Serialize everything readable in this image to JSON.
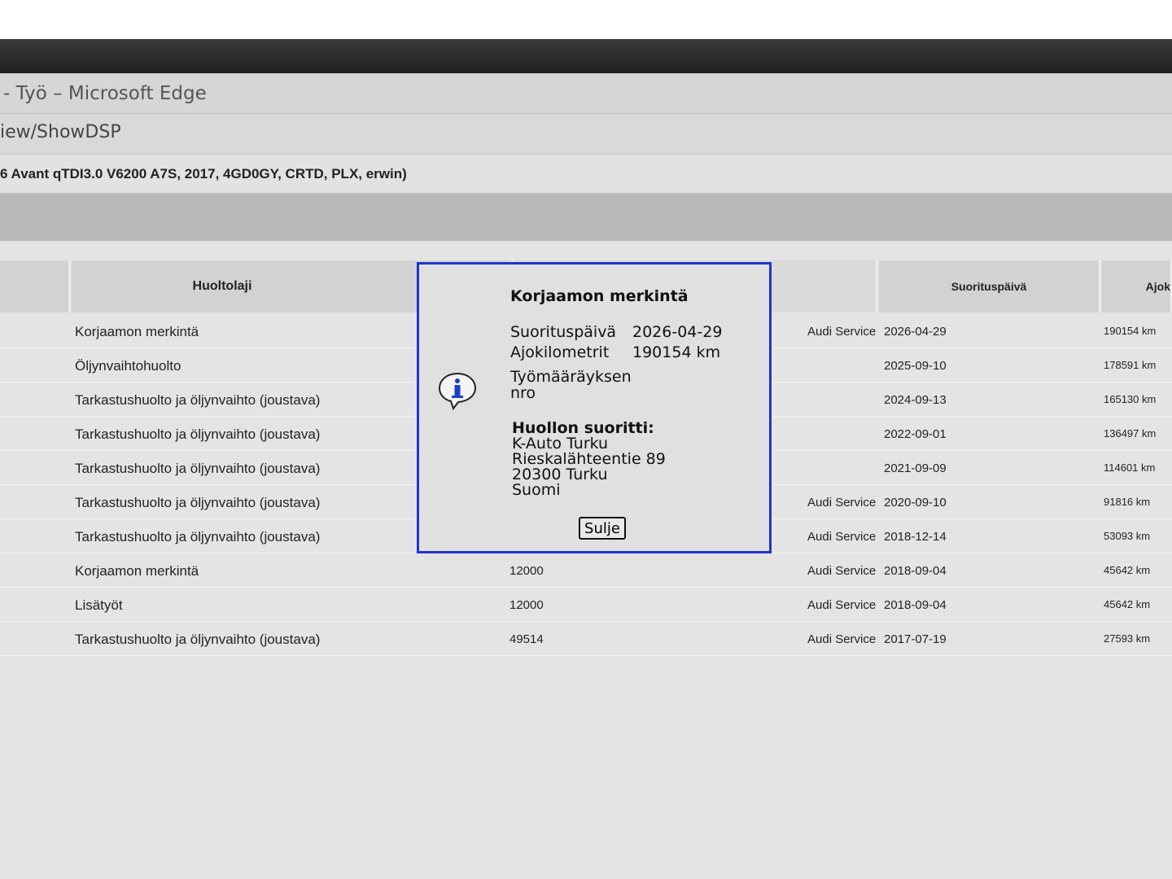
{
  "window": {
    "title": "- Työ – Microsoft Edge",
    "url_fragment": "iew/ShowDSP"
  },
  "vehicle": {
    "info": "6 Avant qTDI3.0 V6200 A7S, 2017, 4GD0GY, CRTD, PLX, erwin)"
  },
  "table": {
    "headers": {
      "service_type": "Huoltolaji",
      "date": "Suorituspäivä",
      "km": "Ajok"
    },
    "rows": [
      {
        "service_type": "Korjaamon merkintä",
        "mid": "",
        "performer": "Audi Service",
        "date": "2026-04-29",
        "km": "190154 km"
      },
      {
        "service_type": "Öljynvaihtohuolto",
        "mid": "",
        "performer": "",
        "date": "2025-09-10",
        "km": "178591 km"
      },
      {
        "service_type": "Tarkastushuolto ja öljynvaihto (joustava)",
        "mid": "",
        "performer": "",
        "date": "2024-09-13",
        "km": "165130 km"
      },
      {
        "service_type": "Tarkastushuolto ja öljynvaihto (joustava)",
        "mid": "",
        "performer": "",
        "date": "2022-09-01",
        "km": "136497 km"
      },
      {
        "service_type": "Tarkastushuolto ja öljynvaihto (joustava)",
        "mid": "",
        "performer": "",
        "date": "2021-09-09",
        "km": "114601 km"
      },
      {
        "service_type": "Tarkastushuolto ja öljynvaihto (joustava)",
        "mid": "",
        "performer": "Audi Service",
        "date": "2020-09-10",
        "km": "91816 km"
      },
      {
        "service_type": "Tarkastushuolto ja öljynvaihto (joustava)",
        "mid": "",
        "performer": "Audi Service",
        "date": "2018-12-14",
        "km": "53093 km"
      },
      {
        "service_type": "Korjaamon merkintä",
        "mid": "12000",
        "performer": "Audi Service",
        "date": "2018-09-04",
        "km": "45642 km"
      },
      {
        "service_type": "Lisätyöt",
        "mid": "12000",
        "performer": "Audi Service",
        "date": "2018-09-04",
        "km": "45642 km"
      },
      {
        "service_type": "Tarkastushuolto ja öljynvaihto (joustava)",
        "mid": "49514",
        "performer": "Audi Service",
        "date": "2017-07-19",
        "km": "27593 km"
      }
    ]
  },
  "dialog": {
    "title": "Korjaamon merkintä",
    "date_label": "Suorituspäivä",
    "date_value": "2026-04-29",
    "km_label": "Ajokilometrit",
    "km_value": "190154 km",
    "order_label_1": "Työmääräyksen",
    "order_label_2": "nro",
    "performed_by_heading": "Huollon suoritti:",
    "performer_name": "K-Auto Turku",
    "performer_street": "Rieskalähteentie 89",
    "performer_city": "20300 Turku",
    "performer_country": "Suomi",
    "close_label": "Sulje",
    "info_icon": "info-icon",
    "border_color": "#2233cc"
  }
}
